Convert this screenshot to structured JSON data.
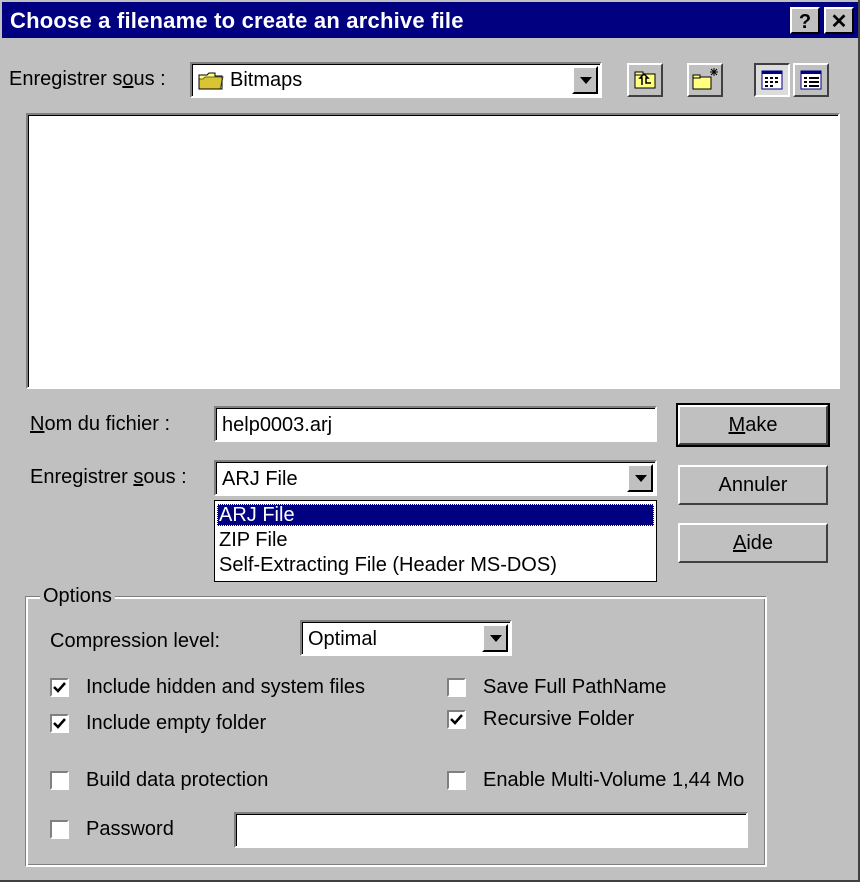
{
  "window": {
    "title": "Choose a filename to create an archive file",
    "help_glyph": "?",
    "close_glyph": "✕"
  },
  "location": {
    "label_pre": "Enregistrer s",
    "label_u": "o",
    "label_post": "us :",
    "value": "Bitmaps",
    "icon": "folder-icon"
  },
  "toolbar": {
    "up_icon": "up-folder-icon",
    "new_folder_icon": "new-folder-icon",
    "list_icon": "list-view-icon",
    "details_icon": "details-view-icon"
  },
  "filename": {
    "label_u": "N",
    "label_post": "om du fichier :",
    "value": "help0003.arj"
  },
  "filetype": {
    "label_pre": "Enregistrer ",
    "label_u": "s",
    "label_post": "ous :",
    "value": "ARJ File",
    "options": [
      "ARJ File",
      "ZIP File",
      "Self-Extracting File (Header MS-DOS)"
    ]
  },
  "buttons": {
    "make_u": "M",
    "make_post": "ake",
    "cancel": "Annuler",
    "help_u": "A",
    "help_post": "ide"
  },
  "options": {
    "group_title": "Options",
    "compression_label": "Compression level:",
    "compression_value": "Optimal",
    "include_hidden": {
      "label": "Include hidden and system files",
      "checked": true
    },
    "include_empty": {
      "label": "Include empty folder",
      "checked": true
    },
    "build_protection": {
      "label": "Build data protection",
      "checked": false
    },
    "password": {
      "label": "Password",
      "checked": false,
      "value": ""
    },
    "save_full_path": {
      "label": "Save Full PathName",
      "checked": false
    },
    "recursive": {
      "label": "Recursive Folder",
      "checked": true
    },
    "multi_volume": {
      "label": "Enable Multi-Volume 1,44 Mo",
      "checked": false
    }
  }
}
